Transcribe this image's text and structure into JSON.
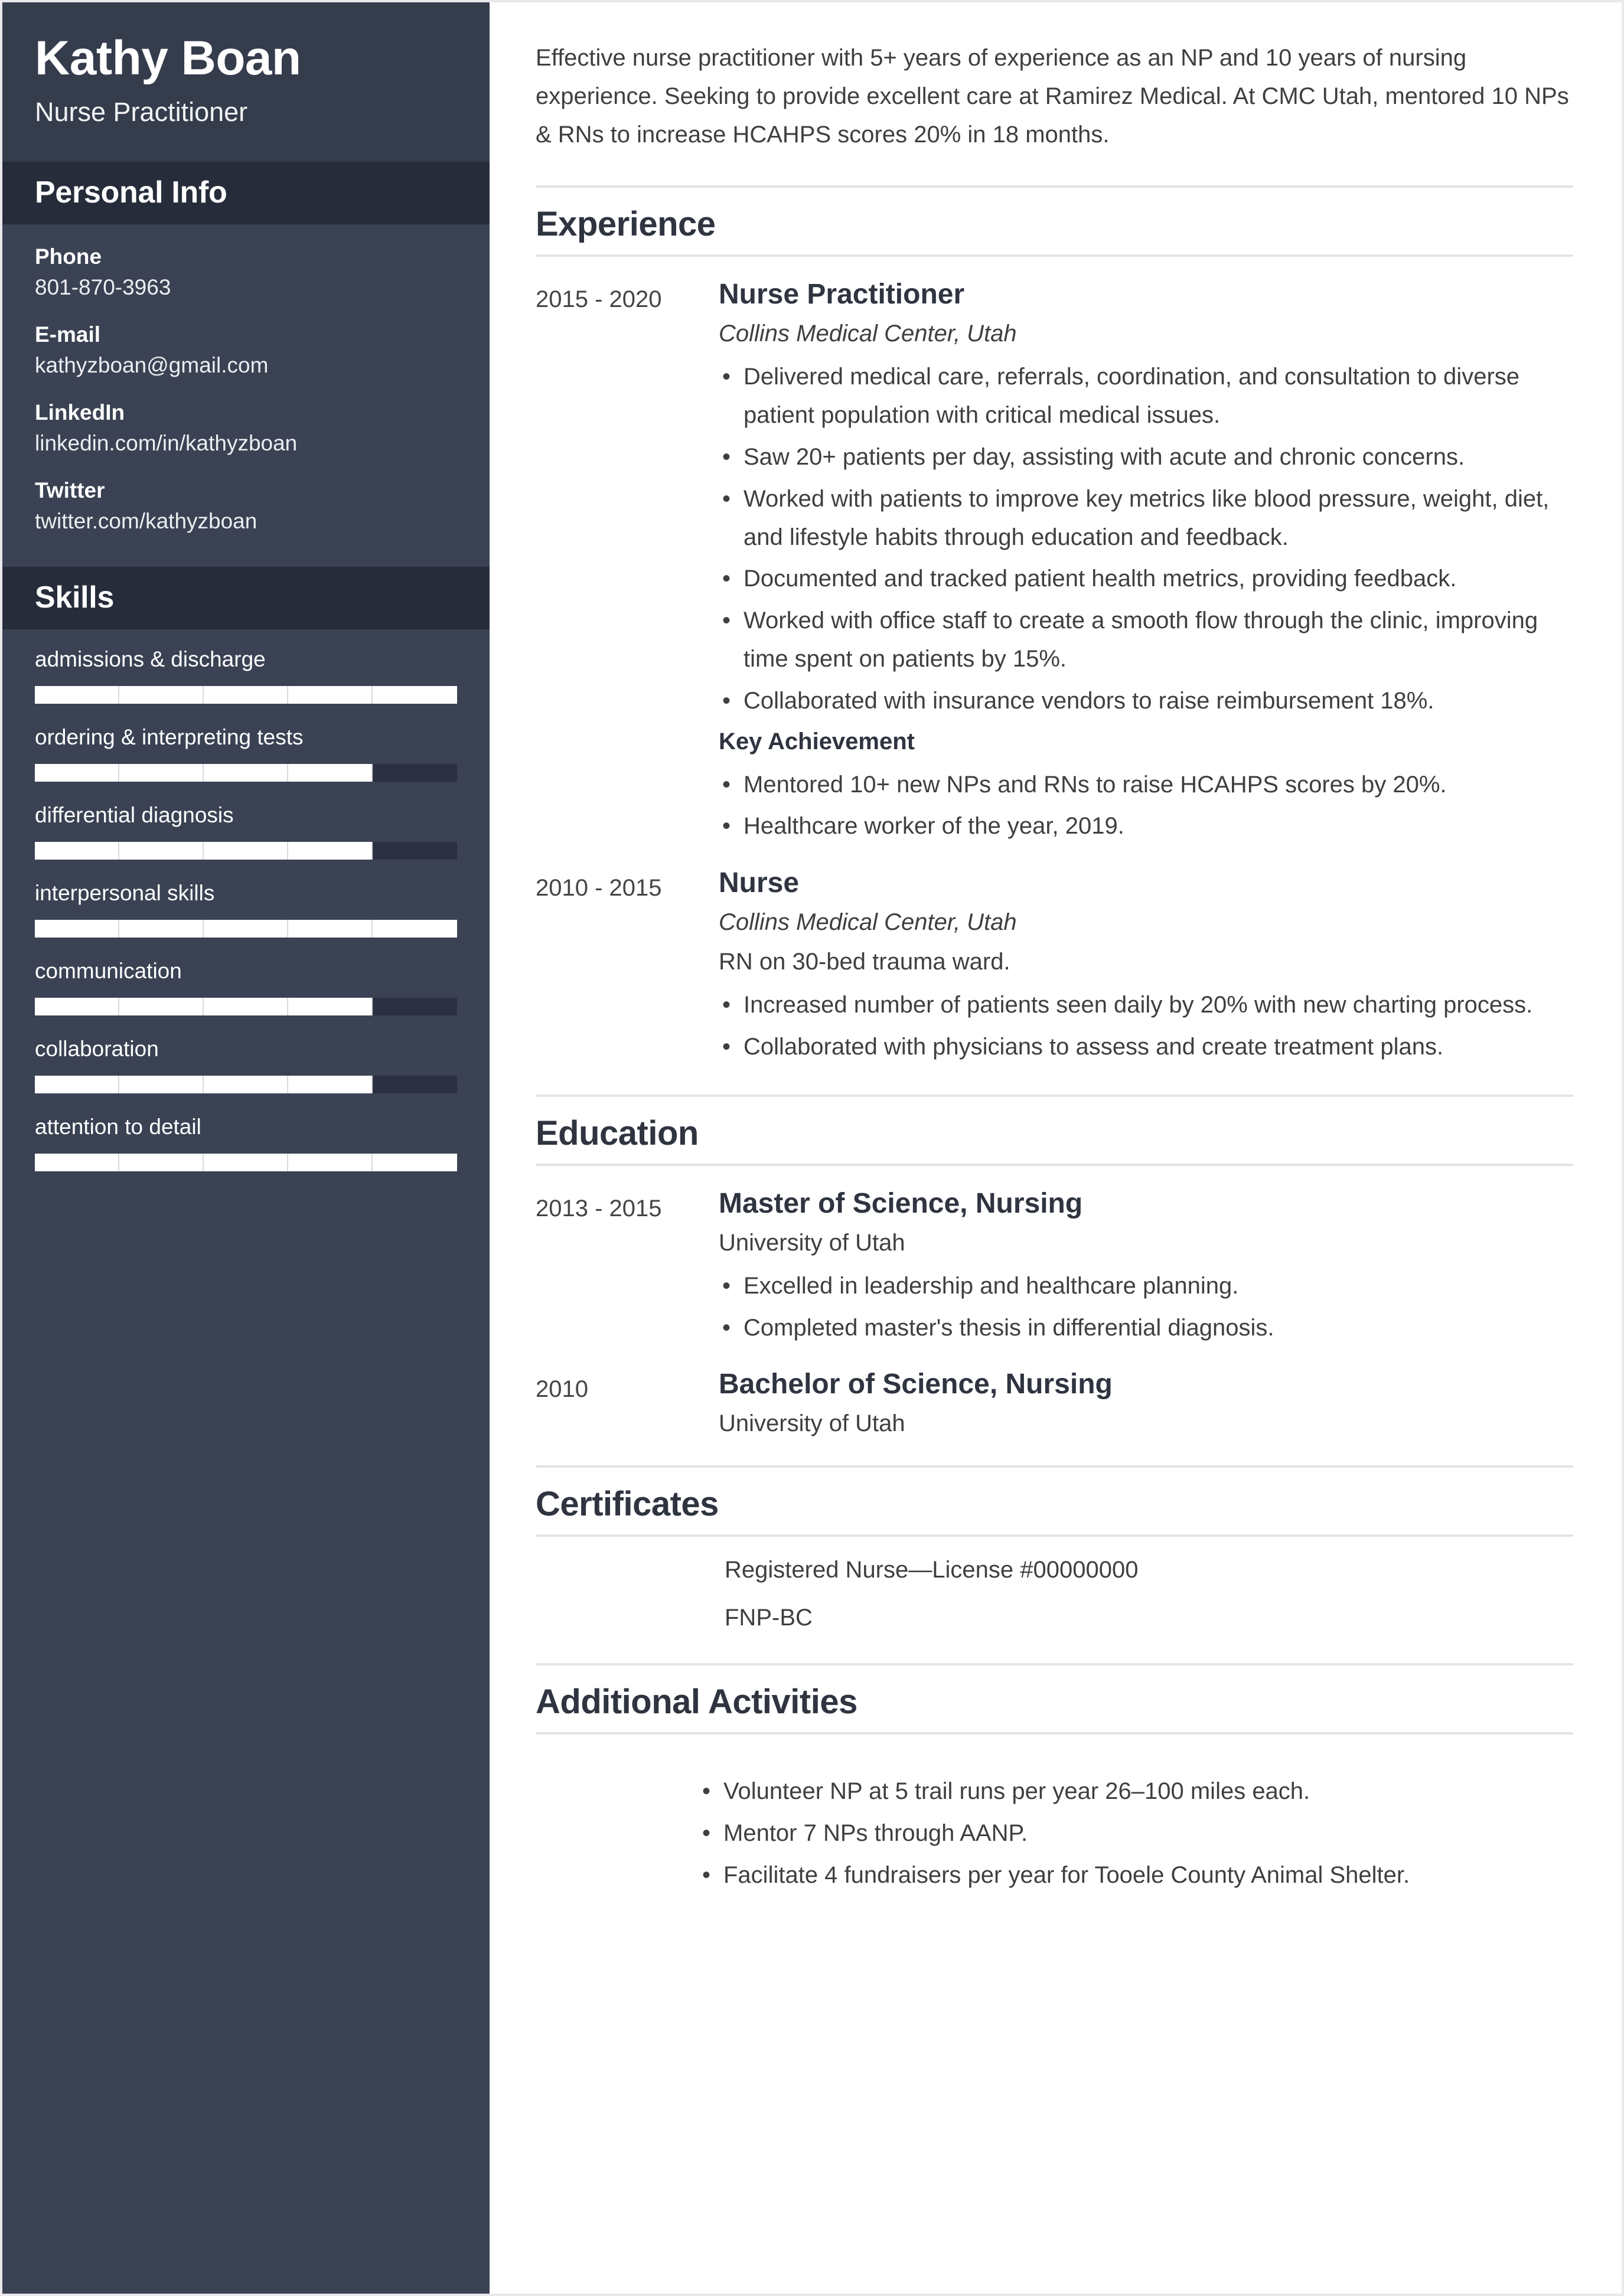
{
  "sidebar": {
    "name": "Kathy Boan",
    "job_title": "Nurse Practitioner",
    "personal_info": {
      "heading": "Personal Info",
      "items": [
        {
          "label": "Phone",
          "value": "801-870-3963"
        },
        {
          "label": "E-mail",
          "value": "kathyzboan@gmail.com"
        },
        {
          "label": "LinkedIn",
          "value": "linkedin.com/in/kathyzboan"
        },
        {
          "label": "Twitter",
          "value": "twitter.com/kathyzboan"
        }
      ]
    },
    "skills": {
      "heading": "Skills",
      "max_level": 5,
      "items": [
        {
          "name": "admissions & discharge",
          "level": 5
        },
        {
          "name": "ordering & interpreting tests",
          "level": 4
        },
        {
          "name": "differential diagnosis",
          "level": 4
        },
        {
          "name": "interpersonal skills",
          "level": 5
        },
        {
          "name": "communication",
          "level": 4
        },
        {
          "name": "collaboration",
          "level": 4
        },
        {
          "name": "attention to detail",
          "level": 5
        }
      ]
    }
  },
  "main": {
    "summary": "Effective nurse practitioner with 5+ years of experience as an NP and 10 years of nursing experience. Seeking to provide excellent care at Ramirez Medical. At CMC Utah, mentored 10 NPs & RNs to increase HCAHPS scores 20% in 18 months.",
    "experience": {
      "heading": "Experience",
      "entries": [
        {
          "dates": "2015 - 2020",
          "title": "Nurse Practitioner",
          "org": "Collins Medical Center, Utah",
          "bullets": [
            "Delivered medical care, referrals, coordination, and consultation to diverse patient population with critical medical issues.",
            "Saw 20+ patients per day, assisting with acute and chronic concerns.",
            "Worked with patients to improve key metrics like blood pressure, weight, diet, and lifestyle habits through education and feedback.",
            "Documented and tracked patient health metrics, providing feedback.",
            "Worked with office staff to create a smooth flow through the clinic, improving time spent on patients by 15%.",
            "Collaborated with insurance vendors to raise reimbursement 18%."
          ],
          "key_achievement_label": "Key Achievement",
          "key_achievements": [
            "Mentored 10+ new NPs and RNs to raise HCAHPS scores by 20%.",
            "Healthcare worker of the year, 2019."
          ]
        },
        {
          "dates": "2010 - 2015",
          "title": "Nurse",
          "org": "Collins Medical Center, Utah",
          "note": "RN on 30-bed trauma ward.",
          "bullets": [
            "Increased number of patients seen daily by 20% with new charting process.",
            "Collaborated with physicians to assess and create treatment plans."
          ]
        }
      ]
    },
    "education": {
      "heading": "Education",
      "entries": [
        {
          "dates": "2013 - 2015",
          "title": "Master of Science, Nursing",
          "org": "University of Utah",
          "bullets": [
            "Excelled in leadership and healthcare planning.",
            "Completed master's thesis in differential diagnosis."
          ]
        },
        {
          "dates": "2010",
          "title": "Bachelor of Science, Nursing",
          "org": "University of Utah",
          "bullets": []
        }
      ]
    },
    "certificates": {
      "heading": "Certificates",
      "items": [
        "Registered Nurse—License #00000000",
        "FNP-BC"
      ]
    },
    "activities": {
      "heading": "Additional Activities",
      "items": [
        "Volunteer NP at 5 trail runs per year 26–100 miles each.",
        "Mentor 7 NPs through AANP.",
        "Facilitate 4 fundraisers per year for Tooele County Animal Shelter."
      ]
    }
  },
  "colors": {
    "sidebar_bg": "#3a4253",
    "sidebar_header_bg": "#262c3a",
    "name_block_bg": "#353c4c",
    "skill_bar_fill": "#ffffff",
    "skill_bar_track": "#2b3140",
    "heading_text": "#2f3440",
    "body_text": "#3f3f3f",
    "rule": "#e3e4e7"
  }
}
